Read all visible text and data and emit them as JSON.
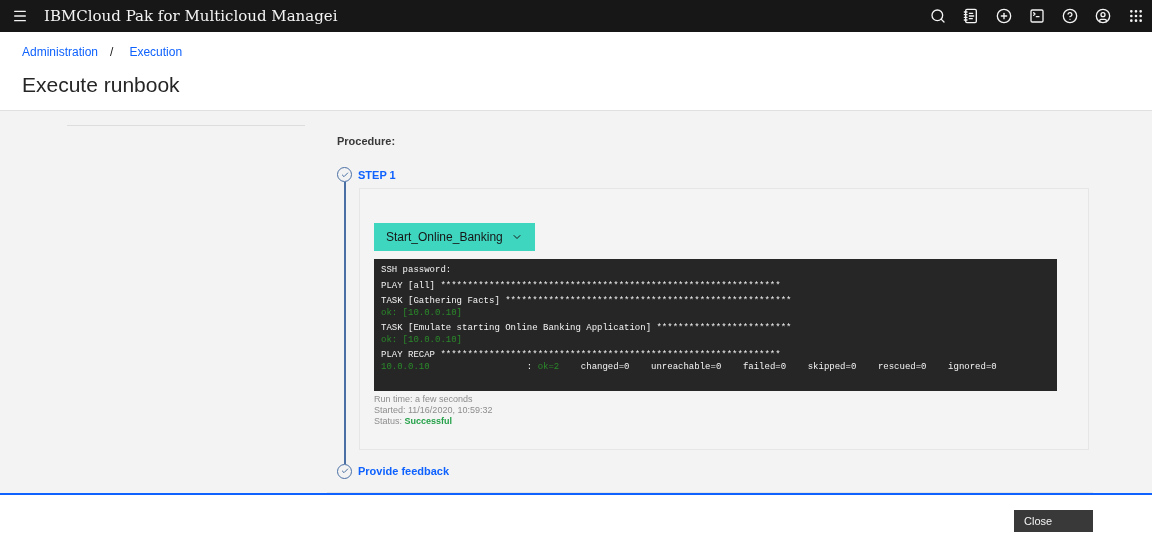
{
  "header": {
    "title": "IBMCloud Pak for Multicloud Managei"
  },
  "breadcrumbs": [
    "Administration",
    "Execution"
  ],
  "breadcrumb_separator": "/",
  "page_title": "Execute runbook",
  "procedure": {
    "heading": "Procedure:",
    "steps": [
      {
        "label": "STEP 1",
        "completed": true
      },
      {
        "label": "Provide feedback",
        "completed": true
      }
    ],
    "playbook_button": "Start_Online_Banking",
    "terminal": [
      [
        {
          "text": "SSH password:",
          "kind": "plain"
        }
      ],
      [
        {
          "text": "PLAY [all] ***************************************************************",
          "kind": "plain"
        }
      ],
      [
        {
          "text": "TASK [Gathering Facts] *****************************************************",
          "kind": "plain"
        }
      ],
      [
        {
          "text": "ok: [10.0.0.10]",
          "kind": "ok"
        }
      ],
      [
        {
          "text": "TASK [Emulate starting Online Banking Application] *************************",
          "kind": "plain"
        }
      ],
      [
        {
          "text": "ok: [10.0.0.10]",
          "kind": "ok"
        }
      ],
      [
        {
          "text": "PLAY RECAP ***************************************************************",
          "kind": "plain"
        }
      ],
      [
        {
          "text": "10.0.0.10",
          "kind": "ok"
        },
        {
          "text": "                  : ",
          "kind": "plain"
        },
        {
          "text": "ok=2",
          "kind": "ok"
        },
        {
          "text": "    changed=0    unreachable=0    failed=0    skipped=0    rescued=0    ignored=0",
          "kind": "plain"
        }
      ]
    ],
    "run_time": "Run time: a few seconds",
    "started": "Started: 11/16/2020, 10:59:32",
    "status_label": "Status:",
    "status_value": "Successful"
  },
  "footer": {
    "close_button": "Close"
  }
}
